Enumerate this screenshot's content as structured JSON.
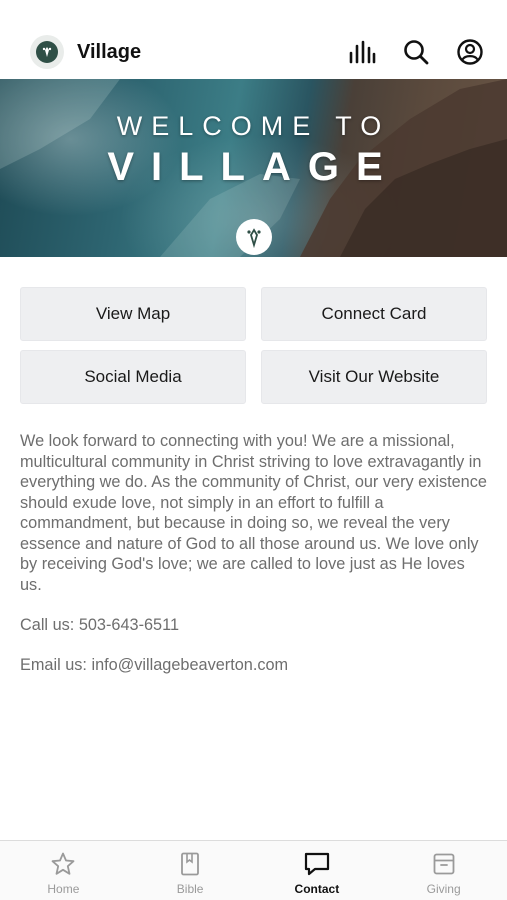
{
  "header": {
    "title": "Village",
    "icons": [
      "logo-icon",
      "equalizer-icon",
      "search-icon",
      "account-icon"
    ]
  },
  "banner": {
    "line1": "WELCOME TO",
    "line2": "VILLAGE"
  },
  "buttons": {
    "view_map": "View Map",
    "connect_card": "Connect Card",
    "social_media": "Social Media",
    "visit_website": "Visit Our Website"
  },
  "content": {
    "description": "We look forward to connecting with you! We are a missional, multicultural community in Christ striving to love extravagantly in everything we do. As the community of Christ, our very existence should exude love, not simply in an effort to fulfill a commandment, but because in doing so, we reveal the very essence and nature of God to all those around us. We love only by receiving God's love; we are called to love just as He loves us.",
    "phone": "Call us: 503-643-6511",
    "email": "Email us: info@villagebeaverton.com"
  },
  "tabs": [
    {
      "label": "Home",
      "icon": "star-icon",
      "active": false
    },
    {
      "label": "Bible",
      "icon": "book-icon",
      "active": false
    },
    {
      "label": "Contact",
      "icon": "chat-icon",
      "active": true
    },
    {
      "label": "Giving",
      "icon": "box-icon",
      "active": false
    }
  ],
  "colors": {
    "accent": "#2f4f46",
    "button_bg": "#eeeff1",
    "body_text": "#6e6e6e"
  }
}
